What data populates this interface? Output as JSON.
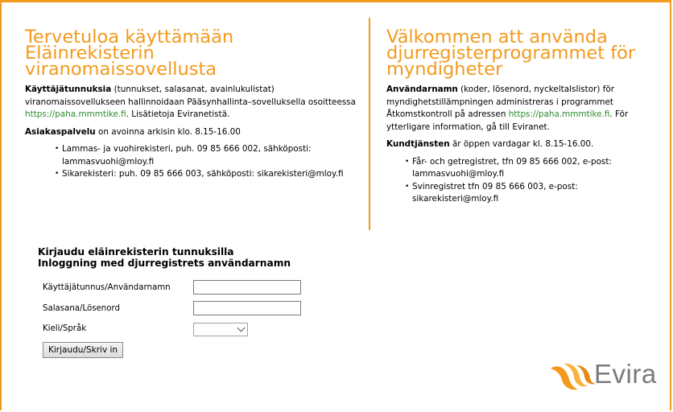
{
  "left": {
    "title_lines": [
      "Tervetuloa käyttämään",
      "Eläinrekisterin",
      "viranomaissovellusta"
    ],
    "p1_bold": "Käyttäjätunnuksia",
    "p1_text": " (tunnukset, salasanat, avainlukulistat) viranomaissovellukseen hallinnoidaan Pääsynhallinta–sovelluksella osoitteessa ",
    "p1_link": "https://paha.mmmtike.fi",
    "p1_after": ". Lisätietoja Eviranetistä.",
    "p2_bold": "Asiakaspalvelu",
    "p2_text": " on avoinna arkisin klo. 8.15-16.00",
    "bullets": [
      "Lammas- ja vuohirekisteri, puh. 09 85 666 002, sähköposti: lammasvuohi@mloy.fi",
      "Sikarekisteri: puh. 09 85 666 003, sähköposti: sikarekisteri@mloy.fi"
    ]
  },
  "right": {
    "title_lines": [
      "Välkommen att använda",
      "djurregisterprogrammet för",
      "myndigheter"
    ],
    "p1_bold": "Användarnamn",
    "p1_text": " (koder, lösenord, nyckeltalslistor) för myndighetstillämpningen administreras i programmet Åtkomstkontroll på adressen ",
    "p1_link": "https://paha.mmmtike.fi",
    "p1_after": ". För ytterligare information, gå till Eviranet.",
    "p2_bold": "Kundtjänsten",
    "p2_text": " är öppen vardagar kl. 8.15-16.00.",
    "bullets": [
      "Får- och getregistret, tfn 09 85 666 002, e-post: lammasvuohi@mloy.fi",
      "Svinregistret tfn 09 85 666 003, e-post: sikarekisteri@mloy.fi"
    ]
  },
  "login": {
    "heading_fi": "Kirjaudu eläinrekisterin tunnuksilla",
    "heading_sv": "Inloggning med djurregistrets användarnamn",
    "username_label": "Käyttäjätunnus/Användarnamn",
    "username_value": "",
    "password_label": "Salasana/Lösenord",
    "password_value": "",
    "language_label": "Kieli/Språk",
    "language_value": "",
    "submit_label": "Kirjaudu/Skriv in"
  },
  "logo": {
    "text": "Evira",
    "icon": "evira-bird-logo"
  },
  "colors": {
    "accent": "#f39a1d",
    "link": "#2a8a2a"
  }
}
